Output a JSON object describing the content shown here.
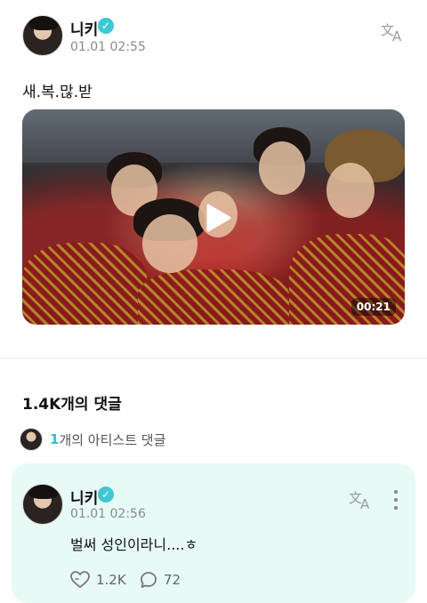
{
  "post": {
    "author": "니키",
    "timestamp": "01.01 02:55",
    "text": "새.복.많.받",
    "video": {
      "duration": "00:21"
    },
    "icons": {
      "verified": "verified-badge-icon",
      "translate": "translate-icon",
      "play": "play-icon"
    }
  },
  "comments": {
    "count_label": "1.4K개의 댓글",
    "artist_count": "1",
    "artist_label": "개의 아티스트 댓글"
  },
  "comment": {
    "author": "니키",
    "timestamp": "01.01 02:56",
    "text": "벌써 성인이라니....ㅎ",
    "likes": "1.2K",
    "replies": "72"
  },
  "colors": {
    "accent": "#3fc8d3",
    "card_bg": "#e8faf6"
  }
}
